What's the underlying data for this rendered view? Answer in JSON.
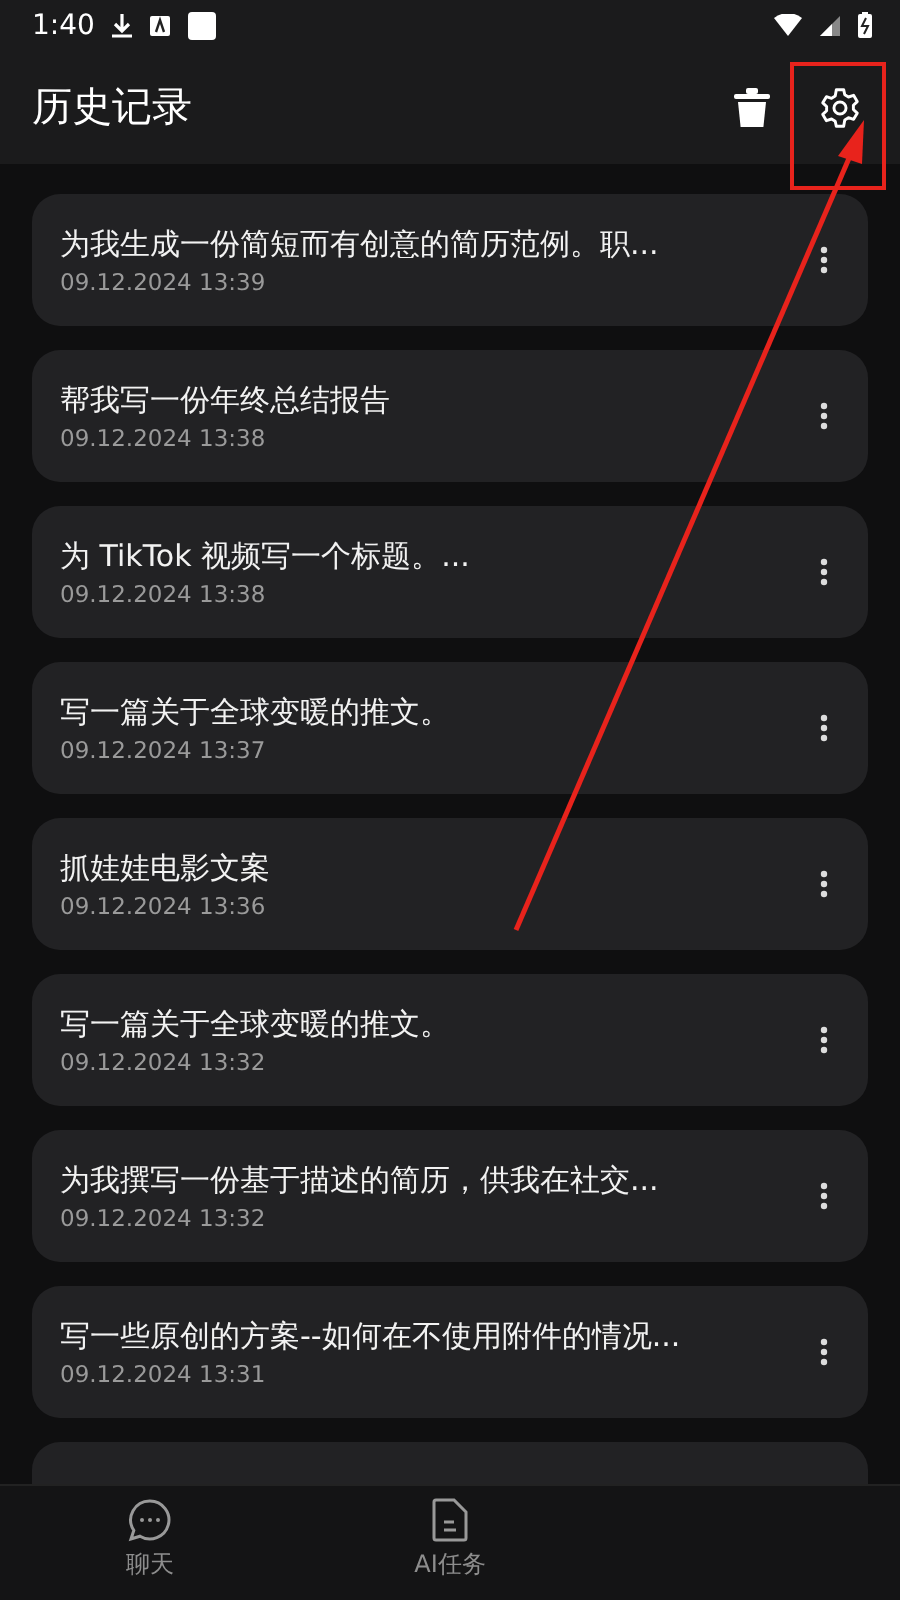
{
  "status_bar": {
    "time": "1:40"
  },
  "header": {
    "title": "历史记录"
  },
  "history": [
    {
      "title": "为我生成一份简短而有创意的简历范例。职...",
      "date": "09.12.2024 13:39"
    },
    {
      "title": "帮我写一份年终总结报告",
      "date": "09.12.2024 13:38"
    },
    {
      "title": "为 TikTok 视频写一个标题。...",
      "date": "09.12.2024 13:38"
    },
    {
      "title": "写一篇关于全球变暖的推文。",
      "date": "09.12.2024 13:37"
    },
    {
      "title": "抓娃娃电影文案",
      "date": "09.12.2024 13:36"
    },
    {
      "title": "写一篇关于全球变暖的推文。",
      "date": "09.12.2024 13:32"
    },
    {
      "title": "为我撰写一份基于描述的简历，供我在社交...",
      "date": "09.12.2024 13:32"
    },
    {
      "title": "写一些原创的方案--如何在不使用附件的情况...",
      "date": "09.12.2024 13:31"
    }
  ],
  "bottom_nav": [
    {
      "label": "聊天",
      "kind": "chat"
    },
    {
      "label": "AI任务",
      "kind": "task"
    }
  ]
}
